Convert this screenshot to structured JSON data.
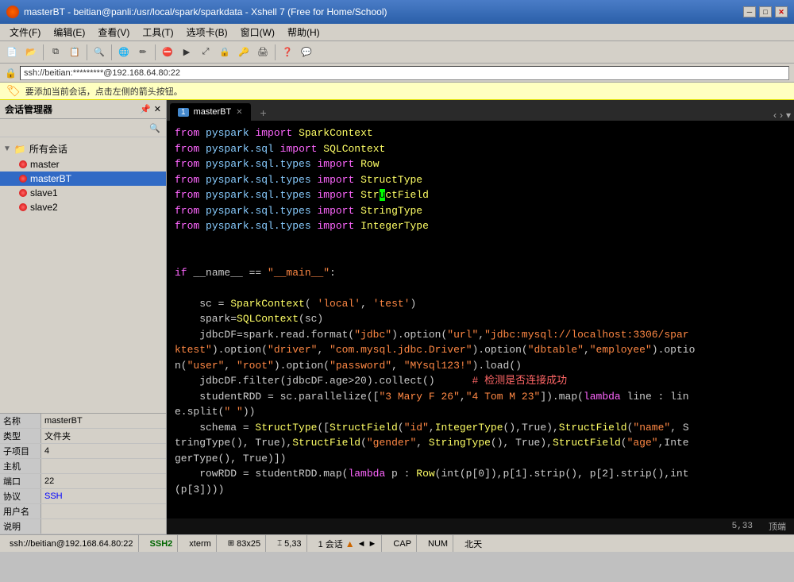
{
  "titlebar": {
    "title": "masterBT - beitian@panli:/usr/local/spark/sparkdata - Xshell 7 (Free for Home/School)",
    "min_label": "─",
    "max_label": "□",
    "close_label": "✕"
  },
  "menubar": {
    "items": [
      "文件(F)",
      "编辑(E)",
      "查看(V)",
      "工具(T)",
      "选项卡(B)",
      "窗口(W)",
      "帮助(H)"
    ]
  },
  "addressbar": {
    "value": "ssh://beitian:*********@192.168.64.80:22"
  },
  "infobar": {
    "message": "要添加当前会话，点击左侧的箭头按钮。"
  },
  "sidebar": {
    "title": "会话管理器",
    "group_label": "所有会话",
    "sessions": [
      "master",
      "masterBT",
      "slave1",
      "slave2"
    ]
  },
  "props": {
    "rows": [
      {
        "label": "名称",
        "value": "masterBT",
        "class": ""
      },
      {
        "label": "类型",
        "value": "文件夹",
        "class": ""
      },
      {
        "label": "子项目",
        "value": "4",
        "class": ""
      },
      {
        "label": "主机",
        "value": "",
        "class": ""
      },
      {
        "label": "端口",
        "value": "22",
        "class": ""
      },
      {
        "label": "协议",
        "value": "SSH",
        "class": "blue"
      },
      {
        "label": "用户名",
        "value": "",
        "class": ""
      },
      {
        "label": "说明",
        "value": "",
        "class": ""
      }
    ]
  },
  "tabs": {
    "active": {
      "num": "1",
      "label": "masterBT"
    },
    "add_label": "+",
    "nav_left": "‹",
    "nav_right": "›"
  },
  "code": {
    "lines": [
      {
        "id": 1,
        "text": "from pyspark import SparkContext"
      },
      {
        "id": 2,
        "text": "from pyspark.sql import SQLContext"
      },
      {
        "id": 3,
        "text": "from pyspark.sql.types import Row"
      },
      {
        "id": 4,
        "text": "from pyspark.sql.types import StructType"
      },
      {
        "id": 5,
        "text": "from pyspark.sql.types import StructField"
      },
      {
        "id": 6,
        "text": "from pyspark.sql.types import StringType"
      },
      {
        "id": 7,
        "text": "from pyspark.sql.types import IntegerType"
      },
      {
        "id": 8,
        "text": ""
      },
      {
        "id": 9,
        "text": ""
      },
      {
        "id": 10,
        "text": "if __name__ == \"__main__\":"
      },
      {
        "id": 11,
        "text": ""
      },
      {
        "id": 12,
        "text": "    sc = SparkContext( 'local', 'test')"
      },
      {
        "id": 13,
        "text": "    spark=SQLContext(sc)"
      },
      {
        "id": 14,
        "text": "    jdbcDF=spark.read.format(\"jdbc\").option(\"url\",\"jdbc:mysql://localhost:3306/spar"
      },
      {
        "id": 15,
        "text": "ktest\").option(\"driver\", \"com.mysql.jdbc.Driver\").option(\"dbtable\",\"employee\").optio"
      },
      {
        "id": 16,
        "text": "n(\"user\", \"root\").option(\"password\", \"MYsql123!\").load()"
      },
      {
        "id": 17,
        "text": "    jdbcDF.filter(jdbcDF.age>20).collect()      # 检测是否连接成功"
      },
      {
        "id": 18,
        "text": "    studentRDD = sc.parallelize([\"3 Mary F 26\",\"4 Tom M 23\"]).map(lambda line : lin"
      },
      {
        "id": 19,
        "text": "e.split(\" \"))"
      },
      {
        "id": 20,
        "text": "    schema = StructType([StructField(\"id\",IntegerType(),True),StructField(\"name\", S"
      },
      {
        "id": 21,
        "text": "tringType(), True),StructField(\"gender\", StringType(), True),StructField(\"age\",Inte"
      },
      {
        "id": 22,
        "text": "gerType(), True)])"
      },
      {
        "id": 23,
        "text": "    rowRDD = studentRDD.map(lambda p : Row(int(p[0]),p[1].strip(), p[2].strip(),int"
      },
      {
        "id": 24,
        "text": "(p[3])))"
      }
    ]
  },
  "position": {
    "line_col": "5,33",
    "label": "顶端"
  },
  "statusbar": {
    "address": "ssh://beitian@192.168.64.80:22",
    "protocol": "SSH2",
    "terminal": "xterm",
    "size": "83x25",
    "pos": "5,33",
    "sessions": "1 会话",
    "caps": "CAP",
    "num": "NUM",
    "time": "北天"
  }
}
